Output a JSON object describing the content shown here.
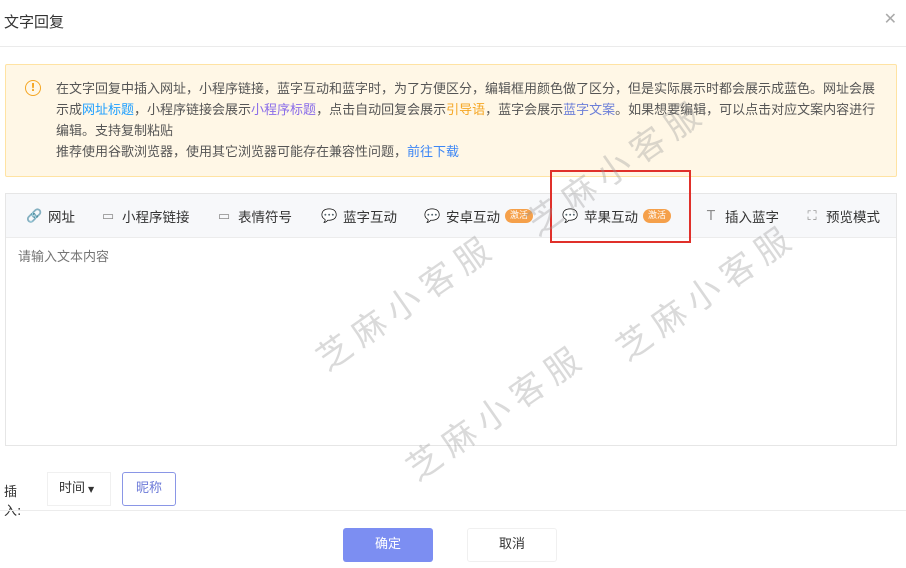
{
  "dialog": {
    "title": "文字回复",
    "close_icon": "close-icon"
  },
  "notice": {
    "p1": "在文字回复中插入网址，小程序链接，蓝字互动和蓝字时，为了方便区分，编辑框用颜色做了区分，但是实际展示时都会展示成蓝色。网址会展示成",
    "w_url_title": "网址标题",
    "p2": "，小程序链接会展示",
    "w_mp_title": "小程序标题",
    "p3": "，点击自动回复会展示",
    "w_guide": "引导语",
    "p4": "，蓝字会展示",
    "w_blue_copy": "蓝字文案",
    "p5": "。如果想要编辑，可以点击对应文案内容进行编辑。支持复制粘贴",
    "line2": "推荐使用谷歌浏览器，使用其它浏览器可能存在兼容性问题，",
    "download_link": "前往下载"
  },
  "toolbar": {
    "items": [
      {
        "label": "网址",
        "icon": "link-icon"
      },
      {
        "label": "小程序链接",
        "icon": "card-icon"
      },
      {
        "label": "表情符号",
        "icon": "card-icon"
      },
      {
        "label": "蓝字互动",
        "icon": "chat-icon"
      },
      {
        "label": "安卓互动",
        "icon": "chat-icon",
        "badge": "激活"
      },
      {
        "label": "苹果互动",
        "icon": "chat-icon",
        "badge": "激活"
      },
      {
        "label": "插入蓝字",
        "icon": "text-icon"
      },
      {
        "label": "预览模式",
        "icon": "fullscreen-icon"
      }
    ]
  },
  "editor": {
    "placeholder": "请输入文本内容"
  },
  "insert": {
    "label": "插入:",
    "select_value": "时间",
    "nickname_button": "昵称"
  },
  "footer": {
    "ok": "确定",
    "cancel": "取消"
  },
  "watermark": "芝麻小客服",
  "colors": {
    "primary": "#7c8ef2",
    "badge": "#f5a04a",
    "highlight": "#e0302a",
    "notice_bg": "#fff7e6"
  }
}
